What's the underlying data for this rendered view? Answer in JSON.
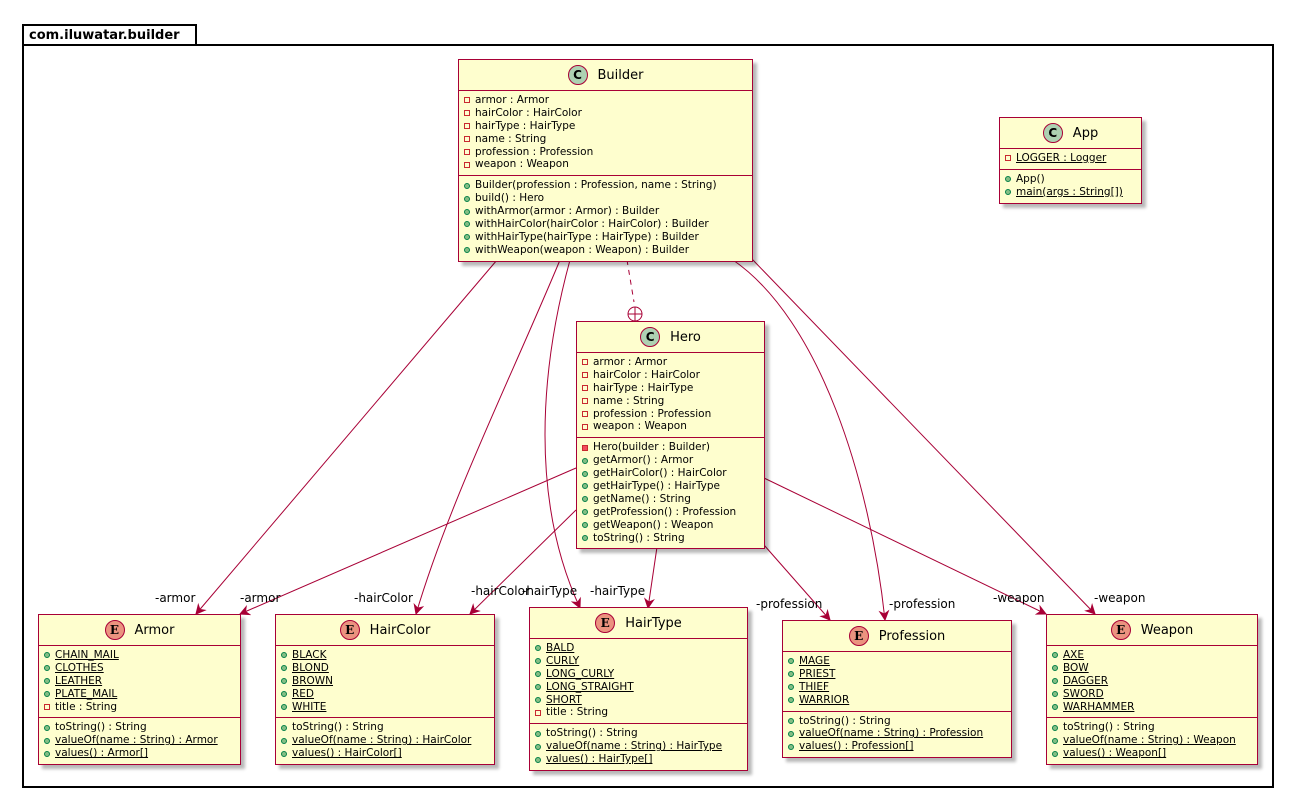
{
  "package": {
    "name": "com.iluwatar.builder"
  },
  "classes": {
    "builder": {
      "name": "Builder",
      "stereotype": "C",
      "fields": [
        {
          "vis": "private",
          "text": "armor : Armor"
        },
        {
          "vis": "private",
          "text": "hairColor : HairColor"
        },
        {
          "vis": "private",
          "text": "hairType : HairType"
        },
        {
          "vis": "private",
          "text": "name : String"
        },
        {
          "vis": "private",
          "text": "profession : Profession"
        },
        {
          "vis": "private",
          "text": "weapon : Weapon"
        }
      ],
      "methods": [
        {
          "vis": "public",
          "text": "Builder(profession : Profession, name : String)"
        },
        {
          "vis": "public",
          "text": "build() : Hero"
        },
        {
          "vis": "public",
          "text": "withArmor(armor : Armor) : Builder"
        },
        {
          "vis": "public",
          "text": "withHairColor(hairColor : HairColor) : Builder"
        },
        {
          "vis": "public",
          "text": "withHairType(hairType : HairType) : Builder"
        },
        {
          "vis": "public",
          "text": "withWeapon(weapon : Weapon) : Builder"
        }
      ]
    },
    "app": {
      "name": "App",
      "stereotype": "C",
      "fields": [
        {
          "vis": "private",
          "text": "LOGGER : Logger",
          "static": true
        }
      ],
      "methods": [
        {
          "vis": "public",
          "text": "App()"
        },
        {
          "vis": "public",
          "text": "main(args : String[])",
          "static": true
        }
      ]
    },
    "hero": {
      "name": "Hero",
      "stereotype": "C",
      "fields": [
        {
          "vis": "private",
          "text": "armor : Armor"
        },
        {
          "vis": "private",
          "text": "hairColor : HairColor"
        },
        {
          "vis": "private",
          "text": "hairType : HairType"
        },
        {
          "vis": "private",
          "text": "name : String"
        },
        {
          "vis": "private",
          "text": "profession : Profession"
        },
        {
          "vis": "private",
          "text": "weapon : Weapon"
        }
      ],
      "methods": [
        {
          "vis": "privatefill",
          "text": "Hero(builder : Builder)"
        },
        {
          "vis": "public",
          "text": "getArmor() : Armor"
        },
        {
          "vis": "public",
          "text": "getHairColor() : HairColor"
        },
        {
          "vis": "public",
          "text": "getHairType() : HairType"
        },
        {
          "vis": "public",
          "text": "getName() : String"
        },
        {
          "vis": "public",
          "text": "getProfession() : Profession"
        },
        {
          "vis": "public",
          "text": "getWeapon() : Weapon"
        },
        {
          "vis": "public",
          "text": "toString() : String"
        }
      ]
    },
    "armor": {
      "name": "Armor",
      "stereotype": "E",
      "fields": [
        {
          "vis": "public",
          "text": "CHAIN_MAIL",
          "static": true
        },
        {
          "vis": "public",
          "text": "CLOTHES",
          "static": true
        },
        {
          "vis": "public",
          "text": "LEATHER",
          "static": true
        },
        {
          "vis": "public",
          "text": "PLATE_MAIL",
          "static": true
        },
        {
          "vis": "private",
          "text": "title : String"
        }
      ],
      "methods": [
        {
          "vis": "public",
          "text": "toString() : String"
        },
        {
          "vis": "public",
          "text": "valueOf(name : String) : Armor",
          "static": true
        },
        {
          "vis": "public",
          "text": "values() : Armor[]",
          "static": true
        }
      ]
    },
    "haircolor": {
      "name": "HairColor",
      "stereotype": "E",
      "fields": [
        {
          "vis": "public",
          "text": "BLACK",
          "static": true
        },
        {
          "vis": "public",
          "text": "BLOND",
          "static": true
        },
        {
          "vis": "public",
          "text": "BROWN",
          "static": true
        },
        {
          "vis": "public",
          "text": "RED",
          "static": true
        },
        {
          "vis": "public",
          "text": "WHITE",
          "static": true
        }
      ],
      "methods": [
        {
          "vis": "public",
          "text": "toString() : String"
        },
        {
          "vis": "public",
          "text": "valueOf(name : String) : HairColor",
          "static": true
        },
        {
          "vis": "public",
          "text": "values() : HairColor[]",
          "static": true
        }
      ]
    },
    "hairtype": {
      "name": "HairType",
      "stereotype": "E",
      "fields": [
        {
          "vis": "public",
          "text": "BALD",
          "static": true
        },
        {
          "vis": "public",
          "text": "CURLY",
          "static": true
        },
        {
          "vis": "public",
          "text": "LONG_CURLY",
          "static": true
        },
        {
          "vis": "public",
          "text": "LONG_STRAIGHT",
          "static": true
        },
        {
          "vis": "public",
          "text": "SHORT",
          "static": true
        },
        {
          "vis": "private",
          "text": "title : String"
        }
      ],
      "methods": [
        {
          "vis": "public",
          "text": "toString() : String"
        },
        {
          "vis": "public",
          "text": "valueOf(name : String) : HairType",
          "static": true
        },
        {
          "vis": "public",
          "text": "values() : HairType[]",
          "static": true
        }
      ]
    },
    "profession": {
      "name": "Profession",
      "stereotype": "E",
      "fields": [
        {
          "vis": "public",
          "text": "MAGE",
          "static": true
        },
        {
          "vis": "public",
          "text": "PRIEST",
          "static": true
        },
        {
          "vis": "public",
          "text": "THIEF",
          "static": true
        },
        {
          "vis": "public",
          "text": "WARRIOR",
          "static": true
        }
      ],
      "methods": [
        {
          "vis": "public",
          "text": "toString() : String"
        },
        {
          "vis": "public",
          "text": "valueOf(name : String) : Profession",
          "static": true
        },
        {
          "vis": "public",
          "text": "values() : Profession[]",
          "static": true
        }
      ]
    },
    "weapon": {
      "name": "Weapon",
      "stereotype": "E",
      "fields": [
        {
          "vis": "public",
          "text": "AXE",
          "static": true
        },
        {
          "vis": "public",
          "text": "BOW",
          "static": true
        },
        {
          "vis": "public",
          "text": "DAGGER",
          "static": true
        },
        {
          "vis": "public",
          "text": "SWORD",
          "static": true
        },
        {
          "vis": "public",
          "text": "WARHAMMER",
          "static": true
        }
      ],
      "methods": [
        {
          "vis": "public",
          "text": "toString() : String"
        },
        {
          "vis": "public",
          "text": "valueOf(name : String) : Weapon",
          "static": true
        },
        {
          "vis": "public",
          "text": "values() : Weapon[]",
          "static": true
        }
      ]
    }
  },
  "edge_labels": {
    "builder_armor": "-armor",
    "hero_armor": "-armor",
    "builder_haircolor": "-hairColor",
    "hero_haircolor": "-hairColor",
    "hero_hairtype": "-hairType",
    "builder_hairtype": "-hairType",
    "hero_profession": "-profession",
    "builder_profession": "-profession",
    "hero_weapon": "-weapon",
    "builder_weapon": "-weapon"
  },
  "colors": {
    "class_fill": "#fefece",
    "class_border": "#a80036",
    "edge": "#a80036",
    "class_badge": "#add1b2",
    "enum_badge": "#eb937f"
  }
}
